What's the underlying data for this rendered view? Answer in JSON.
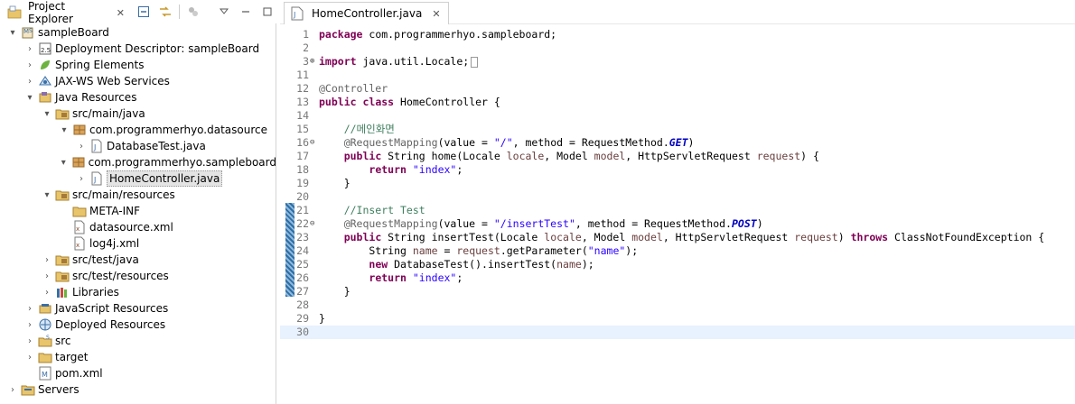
{
  "explorer": {
    "tab_title": "Project Explorer",
    "tab_close": "✕",
    "tree": [
      {
        "depth": 0,
        "arrow": "▾",
        "icon": "web-project-icon",
        "label": "sampleBoard"
      },
      {
        "depth": 1,
        "arrow": "›",
        "icon": "deployment-descriptor-icon",
        "label": "Deployment Descriptor: sampleBoard"
      },
      {
        "depth": 1,
        "arrow": "›",
        "icon": "spring-icon",
        "label": "Spring Elements"
      },
      {
        "depth": 1,
        "arrow": "›",
        "icon": "jax-ws-icon",
        "label": "JAX-WS Web Services"
      },
      {
        "depth": 1,
        "arrow": "▾",
        "icon": "java-resources-icon",
        "label": "Java Resources"
      },
      {
        "depth": 2,
        "arrow": "▾",
        "icon": "source-folder-icon",
        "label": "src/main/java"
      },
      {
        "depth": 3,
        "arrow": "▾",
        "icon": "package-icon",
        "label": "com.programmerhyo.datasource"
      },
      {
        "depth": 4,
        "arrow": "›",
        "icon": "java-file-icon",
        "label": "DatabaseTest.java"
      },
      {
        "depth": 3,
        "arrow": "▾",
        "icon": "package-icon",
        "label": "com.programmerhyo.sampleboard"
      },
      {
        "depth": 4,
        "arrow": "›",
        "icon": "java-file-icon",
        "label": "HomeController.java",
        "selected": true
      },
      {
        "depth": 2,
        "arrow": "▾",
        "icon": "source-folder-icon",
        "label": "src/main/resources"
      },
      {
        "depth": 3,
        "arrow": "",
        "icon": "folder-icon",
        "label": "META-INF"
      },
      {
        "depth": 3,
        "arrow": "",
        "icon": "xml-file-icon",
        "label": "datasource.xml"
      },
      {
        "depth": 3,
        "arrow": "",
        "icon": "xml-file-icon",
        "label": "log4j.xml"
      },
      {
        "depth": 2,
        "arrow": "›",
        "icon": "source-folder-icon",
        "label": "src/test/java"
      },
      {
        "depth": 2,
        "arrow": "›",
        "icon": "source-folder-icon",
        "label": "src/test/resources"
      },
      {
        "depth": 2,
        "arrow": "›",
        "icon": "libraries-icon",
        "label": "Libraries"
      },
      {
        "depth": 1,
        "arrow": "›",
        "icon": "javascript-resources-icon",
        "label": "JavaScript Resources"
      },
      {
        "depth": 1,
        "arrow": "›",
        "icon": "deployed-resources-icon",
        "label": "Deployed Resources"
      },
      {
        "depth": 1,
        "arrow": "›",
        "icon": "src-folder-icon",
        "label": "src"
      },
      {
        "depth": 1,
        "arrow": "›",
        "icon": "folder-icon",
        "label": "target"
      },
      {
        "depth": 1,
        "arrow": "",
        "icon": "maven-pom-icon",
        "label": "pom.xml"
      },
      {
        "depth": 0,
        "arrow": "›",
        "icon": "servers-folder-icon",
        "label": "Servers"
      }
    ]
  },
  "editor": {
    "tab_title": "HomeController.java",
    "tab_close": "✕",
    "lines": [
      {
        "n": "1",
        "fold": "",
        "tokens": [
          [
            "kw",
            "package"
          ],
          [
            "",
            " com.programmerhyo.sampleboard;"
          ]
        ]
      },
      {
        "n": "2",
        "fold": "",
        "tokens": []
      },
      {
        "n": "3",
        "fold": "⊕",
        "tokens": [
          [
            "kw",
            "import"
          ],
          [
            "",
            " java.util.Locale;"
          ],
          [
            "box",
            ""
          ]
        ]
      },
      {
        "n": "11",
        "fold": "",
        "tokens": []
      },
      {
        "n": "12",
        "fold": "",
        "tokens": [
          [
            "ann",
            "@Controller"
          ]
        ]
      },
      {
        "n": "13",
        "fold": "",
        "tokens": [
          [
            "kw",
            "public"
          ],
          [
            "",
            " "
          ],
          [
            "kw",
            "class"
          ],
          [
            "",
            " HomeController {"
          ]
        ]
      },
      {
        "n": "14",
        "fold": "",
        "tokens": []
      },
      {
        "n": "15",
        "fold": "",
        "tokens": [
          [
            "cm",
            "    //메인화면"
          ]
        ]
      },
      {
        "n": "16",
        "fold": "⊖",
        "tokens": [
          [
            "ann",
            "    @RequestMapping"
          ],
          [
            "",
            "(value = "
          ],
          [
            "str",
            "\"/\""
          ],
          [
            "",
            ", method = RequestMethod."
          ],
          [
            "static",
            "GET"
          ],
          [
            "",
            ")"
          ]
        ]
      },
      {
        "n": "17",
        "fold": "",
        "tokens": [
          [
            "",
            "    "
          ],
          [
            "kw",
            "public"
          ],
          [
            "",
            " String home(Locale "
          ],
          [
            "param",
            "locale"
          ],
          [
            "",
            ", Model "
          ],
          [
            "param",
            "model"
          ],
          [
            "",
            ", HttpServletRequest "
          ],
          [
            "param",
            "request"
          ],
          [
            "",
            ") {"
          ]
        ]
      },
      {
        "n": "18",
        "fold": "",
        "tokens": [
          [
            "",
            "        "
          ],
          [
            "kw",
            "return"
          ],
          [
            "",
            " "
          ],
          [
            "str",
            "\"index\""
          ],
          [
            "",
            ";"
          ]
        ]
      },
      {
        "n": "19",
        "fold": "",
        "tokens": [
          [
            "",
            "    }"
          ]
        ]
      },
      {
        "n": "20",
        "fold": "",
        "tokens": []
      },
      {
        "n": "21",
        "fold": "",
        "tokens": [
          [
            "cm",
            "    //Insert Test"
          ]
        ]
      },
      {
        "n": "22",
        "fold": "⊖",
        "tokens": [
          [
            "ann",
            "    @RequestMapping"
          ],
          [
            "",
            "(value = "
          ],
          [
            "str",
            "\"/insertTest\""
          ],
          [
            "",
            ", method = RequestMethod."
          ],
          [
            "static",
            "POST"
          ],
          [
            "",
            ")"
          ]
        ]
      },
      {
        "n": "23",
        "fold": "",
        "tokens": [
          [
            "",
            "    "
          ],
          [
            "kw",
            "public"
          ],
          [
            "",
            " String insertTest(Locale "
          ],
          [
            "param",
            "locale"
          ],
          [
            "",
            ", Model "
          ],
          [
            "param",
            "model"
          ],
          [
            "",
            ", HttpServletRequest "
          ],
          [
            "param",
            "request"
          ],
          [
            "",
            ") "
          ],
          [
            "kw",
            "throws"
          ],
          [
            "",
            " ClassNotFoundException {"
          ]
        ]
      },
      {
        "n": "24",
        "fold": "",
        "tokens": [
          [
            "",
            "        String "
          ],
          [
            "param",
            "name"
          ],
          [
            "",
            " = "
          ],
          [
            "param",
            "request"
          ],
          [
            "",
            ".getParameter("
          ],
          [
            "str",
            "\"name\""
          ],
          [
            "",
            ");"
          ]
        ]
      },
      {
        "n": "25",
        "fold": "",
        "tokens": [
          [
            "",
            "        "
          ],
          [
            "kw",
            "new"
          ],
          [
            "",
            " DatabaseTest().insertTest("
          ],
          [
            "param",
            "name"
          ],
          [
            "",
            ");"
          ]
        ]
      },
      {
        "n": "26",
        "fold": "",
        "tokens": [
          [
            "",
            "        "
          ],
          [
            "kw",
            "return"
          ],
          [
            "",
            " "
          ],
          [
            "str",
            "\"index\""
          ],
          [
            "",
            ";"
          ]
        ]
      },
      {
        "n": "27",
        "fold": "",
        "tokens": [
          [
            "",
            "    }"
          ]
        ]
      },
      {
        "n": "28",
        "fold": "",
        "tokens": []
      },
      {
        "n": "29",
        "fold": "",
        "tokens": [
          [
            "",
            "}"
          ]
        ]
      },
      {
        "n": "30",
        "fold": "",
        "tokens": [],
        "current": true
      }
    ]
  },
  "colors": {
    "keyword": "#7f0055",
    "string": "#2a00ff",
    "comment": "#3f7f5f",
    "annotation": "#646464",
    "parameter": "#6a3e3e",
    "static_field": "#0000c0",
    "current_line": "#e8f2fe"
  }
}
